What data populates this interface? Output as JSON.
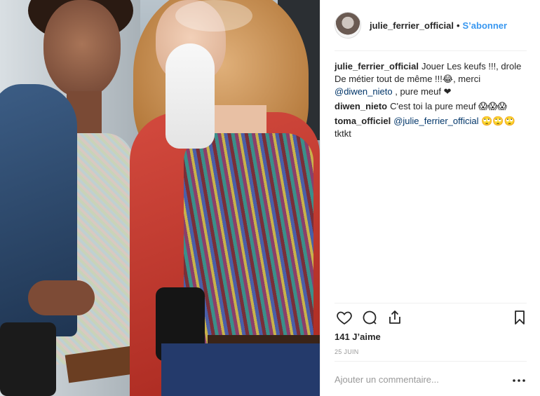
{
  "post": {
    "username": "julie_ferrier_official",
    "separator": "•",
    "follow_label": "S’abonner",
    "comments": [
      {
        "author": "julie_ferrier_official",
        "text_before": "Jouer Les keufs !!!, drole De métier tout de même !!!😂, merci",
        "mention": "@diwen_nieto",
        "text_after": ", pure meuf ❤"
      },
      {
        "author": "diwen_nieto",
        "text_before": "C'est toi la pure meuf 😱😱😱",
        "mention": "",
        "text_after": ""
      },
      {
        "author": "toma_officiel",
        "text_before": "",
        "mention": "@julie_ferrier_official",
        "text_after": "🙄🙄🙄 tktkt"
      }
    ],
    "likes": "141 J’aime",
    "date": "25 JUIN",
    "comment_placeholder": "Ajouter un commentaire...",
    "icons": {
      "like": "heart-icon",
      "comment": "speech-bubble-icon",
      "share": "share-icon",
      "save": "bookmark-icon",
      "more": "more-dots-icon"
    }
  }
}
